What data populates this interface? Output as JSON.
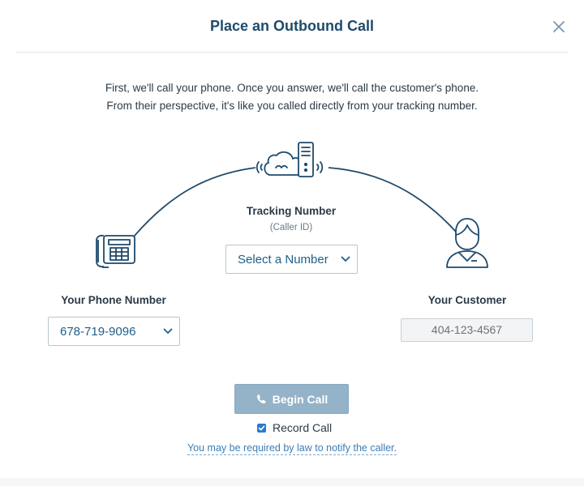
{
  "modal": {
    "title": "Place an Outbound Call",
    "close_icon": "close-icon"
  },
  "description": {
    "line1": "First, we'll call your phone. Once you answer, we'll call the customer's phone.",
    "line2": "From their perspective, it's like you called directly from your tracking number."
  },
  "tracking": {
    "label": "Tracking Number",
    "sublabel": "(Caller ID)",
    "select_value": "Select a Number",
    "icon": "cloud-server-icon"
  },
  "your_phone": {
    "label": "Your Phone Number",
    "select_value": "678-719-9096",
    "icon": "desk-phone-icon"
  },
  "customer": {
    "label": "Your Customer",
    "value": "404-123-4567",
    "icon": "customer-avatar-icon"
  },
  "actions": {
    "begin_call_label": "Begin Call",
    "record_call_label": "Record Call",
    "record_call_checked": true,
    "law_notice": "You may be required by law to notify the caller."
  },
  "colors": {
    "title": "#1f4a6b",
    "accent": "#1f5f8b",
    "button": "#94b3c9",
    "checkbox": "#2a7ad0",
    "link": "#3d7db5"
  }
}
